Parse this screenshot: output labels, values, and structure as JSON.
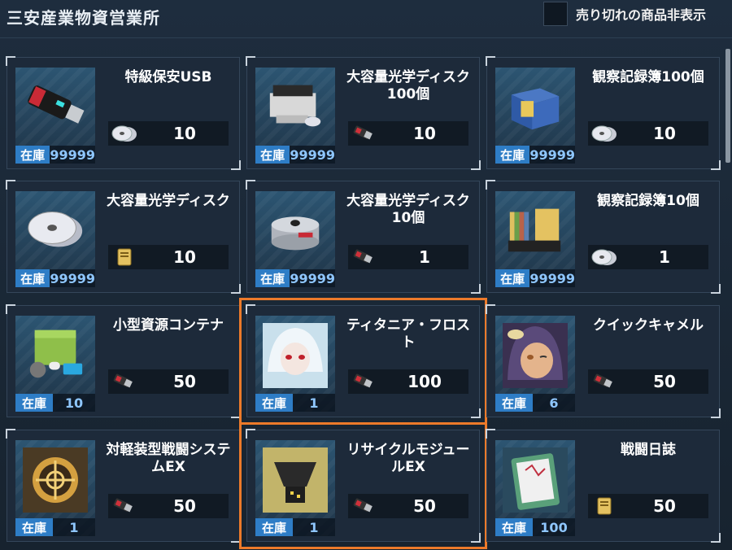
{
  "header": {
    "title": "三安産業物資営業所",
    "filter_label": "売り切れの商品非表示"
  },
  "stock_label": "在庫",
  "items": [
    {
      "name": "特級保安USB",
      "stock": "99999",
      "price": "10",
      "currency": "disc-icon",
      "icon": "usb-icon",
      "selected": false
    },
    {
      "name": "大容量光学ディスク100個",
      "stock": "99999",
      "price": "10",
      "currency": "usb-icon",
      "icon": "printer-icon",
      "selected": false
    },
    {
      "name": "観察記録簿100個",
      "stock": "99999",
      "price": "10",
      "currency": "disc-icon",
      "icon": "box-icon",
      "selected": false
    },
    {
      "name": "大容量光学ディスク",
      "stock": "99999",
      "price": "10",
      "currency": "notebook-icon",
      "icon": "disc-icon",
      "selected": false
    },
    {
      "name": "大容量光学ディスク10個",
      "stock": "99999",
      "price": "1",
      "currency": "usb-icon",
      "icon": "disc-spindle-icon",
      "selected": false
    },
    {
      "name": "観察記録簿10個",
      "stock": "99999",
      "price": "1",
      "currency": "disc-icon",
      "icon": "notebook-rack-icon",
      "selected": false
    },
    {
      "name": "小型資源コンテナ",
      "stock": "10",
      "price": "50",
      "currency": "usb-icon",
      "icon": "container-icon",
      "selected": false
    },
    {
      "name": "ティタニア・フロスト",
      "stock": "1",
      "price": "100",
      "currency": "usb-icon",
      "icon": "white-hair-portrait-icon",
      "selected": true
    },
    {
      "name": "クイックキャメル",
      "stock": "6",
      "price": "50",
      "currency": "usb-icon",
      "icon": "winking-portrait-icon",
      "selected": false
    },
    {
      "name": "対軽装型戦闘システムEX",
      "stock": "1",
      "price": "50",
      "currency": "usb-icon",
      "icon": "target-emblem-icon",
      "selected": false
    },
    {
      "name": "リサイクルモジュールEX",
      "stock": "1",
      "price": "50",
      "currency": "usb-icon",
      "icon": "hopper-icon",
      "selected": true
    },
    {
      "name": "戦闘日誌",
      "stock": "100",
      "price": "50",
      "currency": "notebook-icon",
      "icon": "log-tablet-icon",
      "selected": false
    }
  ]
}
